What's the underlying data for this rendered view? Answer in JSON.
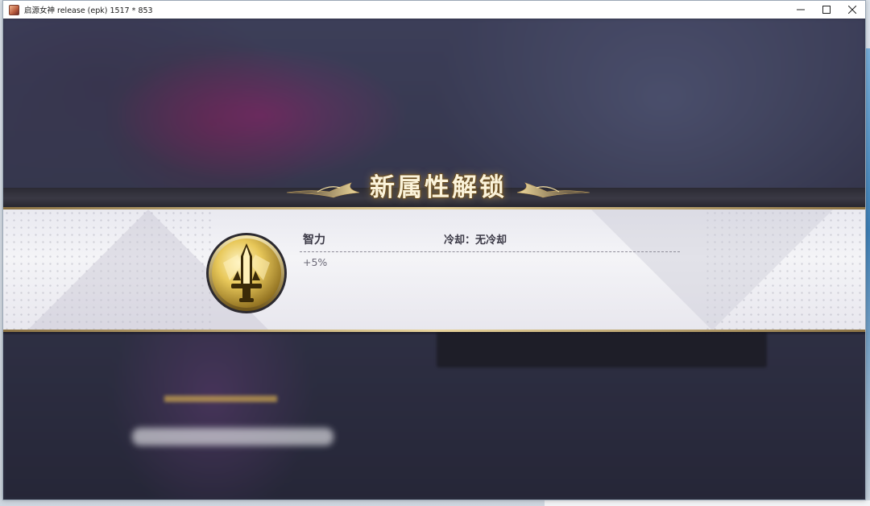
{
  "window": {
    "title": "启源女神 release (epk) 1517 * 853",
    "controls": {
      "minimize": "—",
      "maximize": "☐",
      "close": "✕"
    }
  },
  "popup": {
    "title": "新属性解锁",
    "attribute": {
      "name": "智力",
      "cooldown": "冷却：无冷却",
      "value": "+5%",
      "icon": "sword-medal-icon"
    }
  },
  "colors": {
    "gold": "#e8d39b",
    "panel": "#f1f1f5",
    "title_text": "#fbf3da"
  }
}
